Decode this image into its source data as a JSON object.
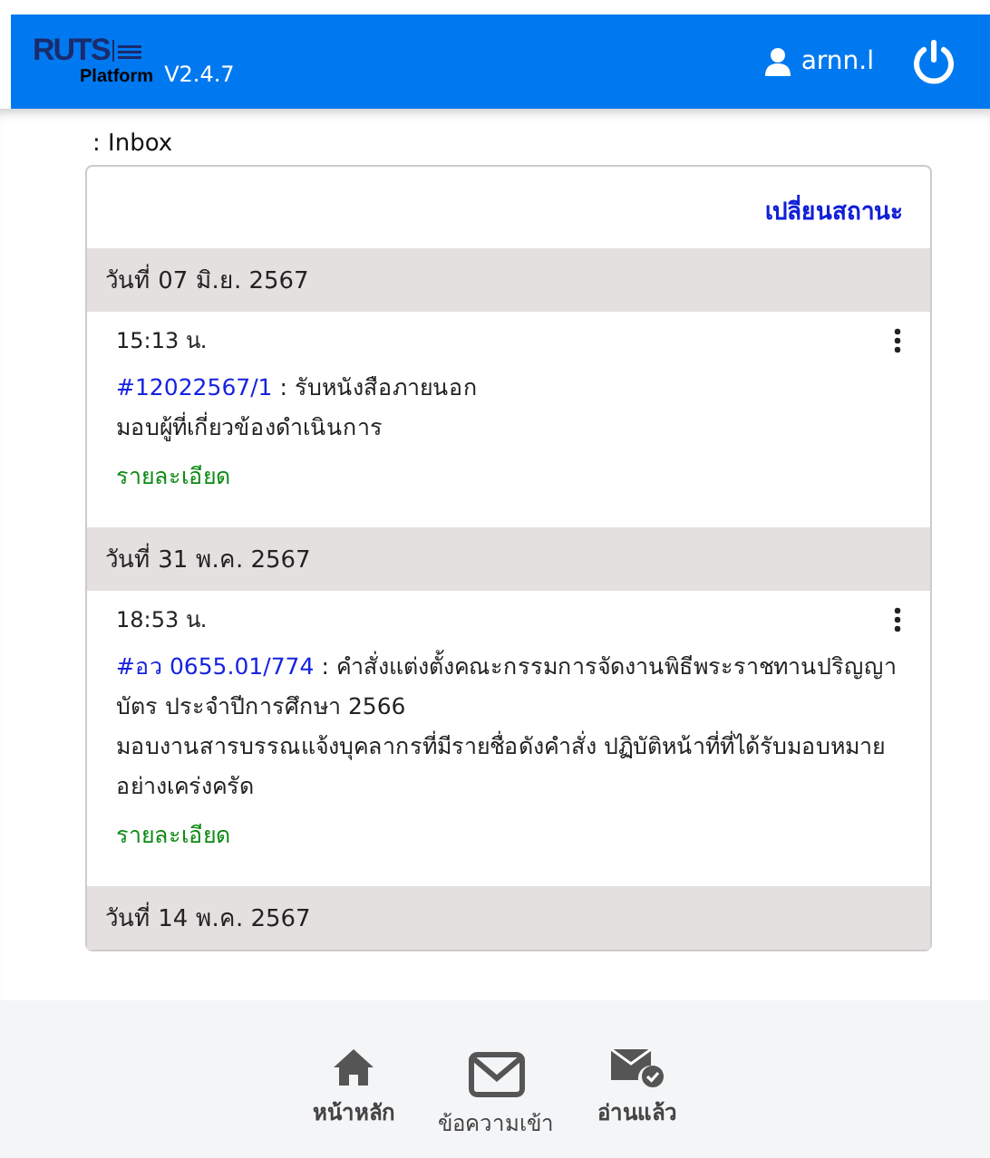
{
  "header": {
    "logo": "RUTS",
    "logo_sub": "Platform",
    "version": "V2.4.7",
    "user": "arnn.l"
  },
  "breadcrumb": ": Inbox",
  "change_status": "เปลี่ยนสถานะ",
  "groups": [
    {
      "date": "วันที่ 07 มิ.ย. 2567",
      "items": [
        {
          "time": "15:13 น.",
          "doc_no": "#12022567/1",
          "title": " : รับหนังสือภายนอก",
          "note": "มอบผู้ที่เกี่ยวข้องดำเนินการ",
          "detail": "รายละเอียด"
        }
      ]
    },
    {
      "date": "วันที่ 31 พ.ค. 2567",
      "items": [
        {
          "time": "18:53 น.",
          "doc_no": "#อว 0655.01/774",
          "title": " : คำสั่งแต่งตั้งคณะกรรมการจัดงานพิธีพระราชทานปริญญาบัตร ประจำปีการศึกษา 2566",
          "note": "มอบงานสารบรรณแจ้งบุคลากรที่มีรายชื่อดังคำสั่ง ปฏิบัติหน้าที่ที่ได้รับมอบหมายอย่างเคร่งครัด",
          "detail": "รายละเอียด"
        }
      ]
    },
    {
      "date": "วันที่ 14 พ.ค. 2567"
    }
  ],
  "nav": [
    {
      "kind": "home",
      "label": "หน้าหลัก",
      "selected": false
    },
    {
      "kind": "inbox",
      "label": "ข้อความเข้า",
      "selected": true
    },
    {
      "kind": "read",
      "label": "อ่านแล้ว",
      "selected": false
    }
  ]
}
